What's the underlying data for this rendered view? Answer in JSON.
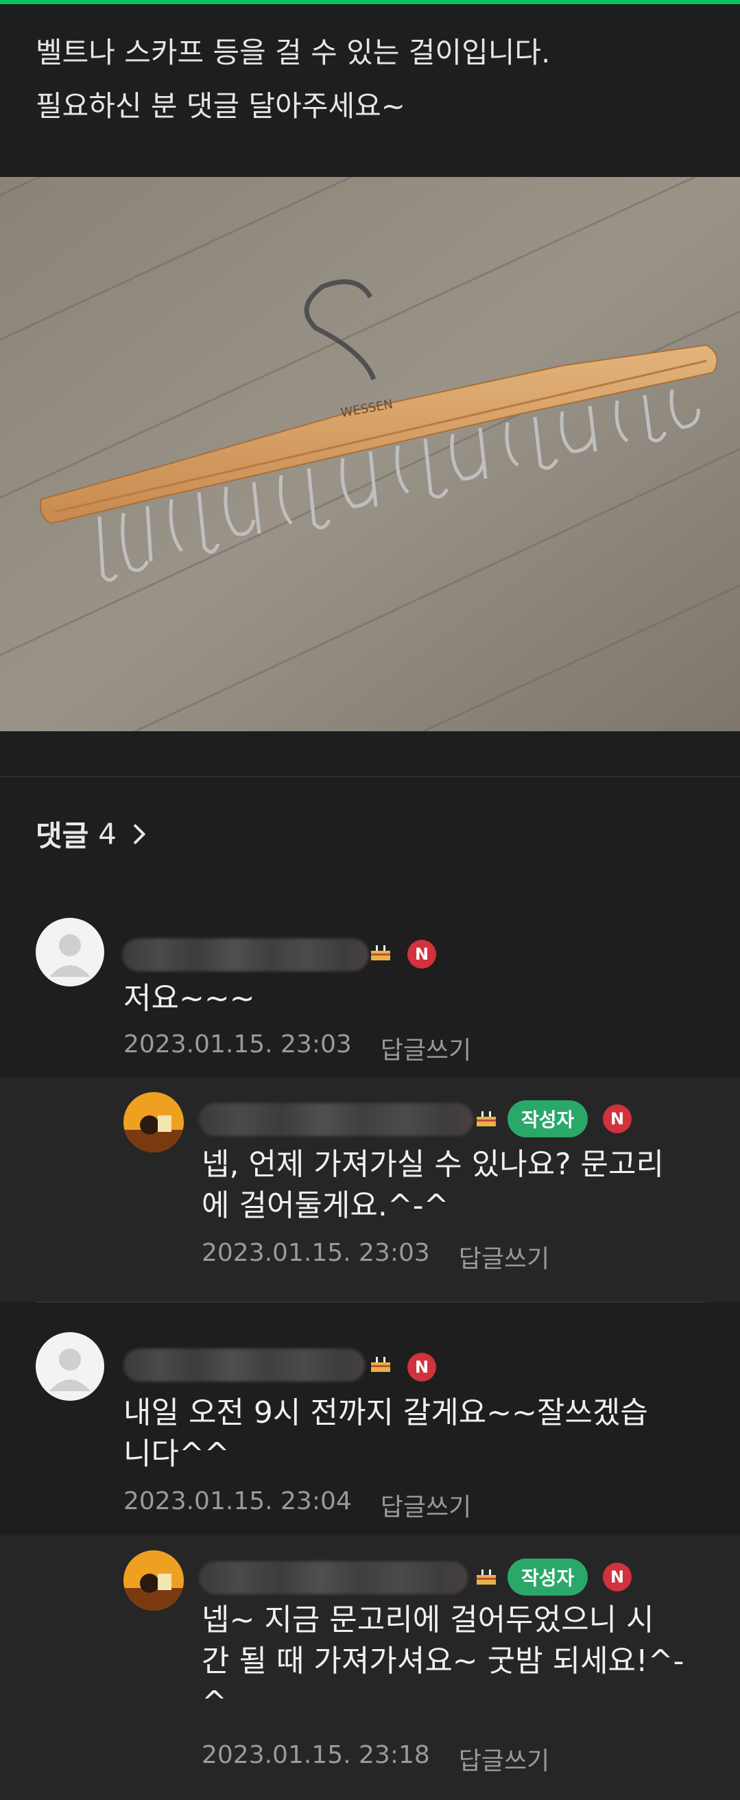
{
  "post": {
    "line1": "벨트나 스카프 등을 걸 수 있는 걸이입니다.",
    "line2": "필요하신 분 댓글 달아주세요~",
    "photo_brand": "WESSEN"
  },
  "comments_header": {
    "label": "댓글",
    "count": "4"
  },
  "comments": [
    {
      "text_lines": [
        "저요~~~"
      ],
      "date": "2023.01.15. 23:03",
      "reply_label": "답글쓰기",
      "badge_n": "N"
    },
    {
      "text_lines": [
        "넵, 언제 가져가실 수 있나요? 문고리",
        "에 걸어둘게요.^-^"
      ],
      "date": "2023.01.15. 23:03",
      "reply_label": "답글쓰기",
      "author_badge": "작성자",
      "badge_n": "N"
    },
    {
      "text_lines": [
        "내일 오전 9시 전까지 갈게요~~잘쓰겠습",
        "니다^^"
      ],
      "date": "2023.01.15. 23:04",
      "reply_label": "답글쓰기",
      "badge_n": "N"
    },
    {
      "text_lines": [
        "넵~ 지금 문고리에 걸어두었으니 시",
        "간 될 때 가져가셔요~ 굿밤 되세요!^-",
        "^"
      ],
      "date": "2023.01.15. 23:18",
      "reply_label": "답글쓰기",
      "author_badge": "작성자",
      "badge_n": "N"
    }
  ],
  "colors": {
    "accent": "#03c75a",
    "author_badge": "#2aa86a",
    "new_badge": "#d1323b",
    "background": "#1e1e1e"
  }
}
